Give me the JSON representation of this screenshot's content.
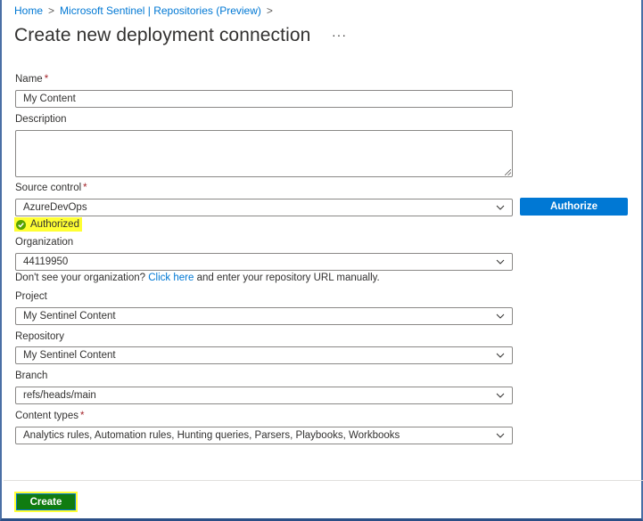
{
  "breadcrumb": {
    "items": [
      "Home",
      "Microsoft Sentinel | Repositories (Preview)"
    ],
    "separator": ">"
  },
  "page": {
    "title": "Create new deployment connection",
    "more_label": "···"
  },
  "form": {
    "name": {
      "label": "Name",
      "required_mark": "*",
      "value": "My Content"
    },
    "description": {
      "label": "Description",
      "value": ""
    },
    "source_control": {
      "label": "Source control",
      "required_mark": "*",
      "value": "AzureDevOps"
    },
    "authorize_label": "Authorize",
    "authorized_status": "Authorized",
    "organization": {
      "label": "Organization",
      "value": "44119950"
    },
    "helper": {
      "prefix": "Don't see your organization? ",
      "link": "Click here",
      "suffix": " and enter your repository URL manually."
    },
    "project": {
      "label": "Project",
      "value": "My Sentinel Content"
    },
    "repository": {
      "label": "Repository",
      "value": "My Sentinel Content"
    },
    "branch": {
      "label": "Branch",
      "value": "refs/heads/main"
    },
    "content_types": {
      "label": "Content types",
      "required_mark": "*",
      "value": "Analytics rules, Automation rules, Hunting queries, Parsers, Playbooks, Workbooks"
    }
  },
  "footer": {
    "create_label": "Create"
  },
  "colors": {
    "link": "#0078d4",
    "primary_button": "#0078d4",
    "create_button": "#107c10",
    "highlight": "#ffff33",
    "success": "#107c10"
  }
}
